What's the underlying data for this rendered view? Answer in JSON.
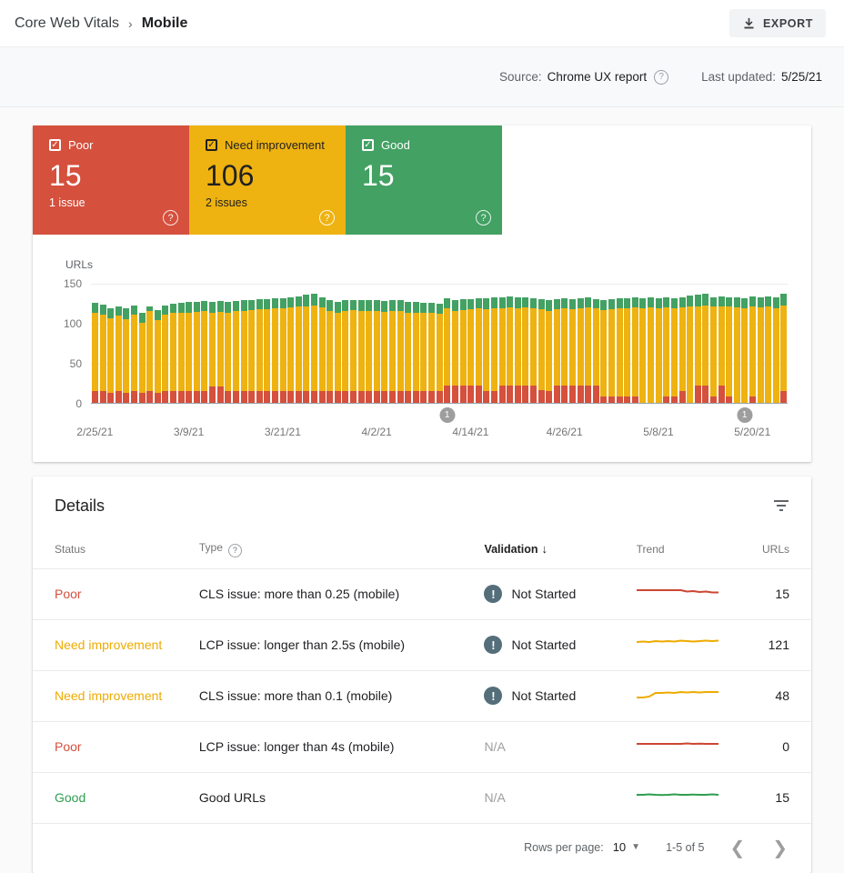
{
  "header": {
    "breadcrumb_root": "Core Web Vitals",
    "breadcrumb_sep": "›",
    "breadcrumb_current": "Mobile",
    "export_label": "EXPORT"
  },
  "source_bar": {
    "source_label": "Source:",
    "source_value": "Chrome UX report",
    "help_icon": "?",
    "updated_label": "Last updated:",
    "updated_value": "5/25/21"
  },
  "summary_cards": [
    {
      "label": "Poor",
      "count": "15",
      "sub": "1 issue",
      "bg": "#d5503d",
      "fg": "#ffffff",
      "check": "✓",
      "help": "?"
    },
    {
      "label": "Need improvement",
      "count": "106",
      "sub": "2 issues",
      "bg": "#eeb211",
      "fg": "#212121",
      "check": "✓",
      "help": "?"
    },
    {
      "label": "Good",
      "count": "15",
      "sub": "",
      "bg": "#43a163",
      "fg": "#ffffff",
      "check": "✓",
      "help": "?"
    }
  ],
  "chart_data": {
    "type": "bar",
    "stacked": true,
    "ylabel": "URLs",
    "ylim": [
      0,
      150
    ],
    "yticks": [
      "150",
      "100",
      "50",
      "0"
    ],
    "grid": true,
    "n_bars": 89,
    "x_tick_labels": [
      "2/25/21",
      "3/9/21",
      "3/21/21",
      "4/2/21",
      "4/14/21",
      "4/26/21",
      "5/8/21",
      "5/20/21"
    ],
    "x_tick_indices": [
      0,
      12,
      24,
      36,
      48,
      60,
      72,
      84
    ],
    "markers": [
      {
        "index": 45,
        "label": "1"
      },
      {
        "index": 83,
        "label": "1"
      }
    ],
    "series": [
      {
        "name": "Poor",
        "color": "#d5503d",
        "values": [
          15,
          15,
          13,
          15,
          13,
          15,
          12,
          15,
          13,
          15,
          15,
          15,
          15,
          15,
          15,
          20,
          20,
          15,
          15,
          15,
          15,
          15,
          15,
          15,
          15,
          15,
          15,
          15,
          15,
          15,
          15,
          15,
          15,
          15,
          15,
          15,
          15,
          15,
          15,
          15,
          15,
          15,
          15,
          15,
          15,
          22,
          22,
          22,
          22,
          22,
          15,
          15,
          22,
          22,
          22,
          22,
          22,
          16,
          15,
          22,
          22,
          22,
          22,
          22,
          22,
          8,
          8,
          8,
          8,
          8,
          0,
          0,
          0,
          8,
          8,
          15,
          0,
          22,
          22,
          8,
          22,
          8,
          0,
          0,
          8,
          0,
          0,
          0,
          15
        ]
      },
      {
        "name": "Need improvement",
        "color": "#eeb211",
        "values": [
          97,
          95,
          93,
          94,
          92,
          95,
          88,
          100,
          90,
          95,
          97,
          98,
          98,
          99,
          100,
          93,
          94,
          98,
          100,
          100,
          101,
          102,
          102,
          103,
          103,
          104,
          105,
          106,
          107,
          104,
          100,
          98,
          100,
          101,
          100,
          100,
          100,
          99,
          100,
          100,
          98,
          98,
          97,
          97,
          96,
          96,
          93,
          94,
          95,
          96,
          102,
          103,
          96,
          97,
          96,
          97,
          96,
          101,
          100,
          95,
          96,
          95,
          96,
          97,
          96,
          108,
          109,
          110,
          110,
          111,
          118,
          119,
          118,
          111,
          110,
          104,
          120,
          99,
          100,
          112,
          99,
          112,
          119,
          118,
          112,
          119,
          120,
          118,
          107
        ]
      },
      {
        "name": "Good",
        "color": "#43a163",
        "values": [
          13,
          13,
          12,
          12,
          13,
          12,
          12,
          5,
          13,
          12,
          12,
          12,
          13,
          12,
          12,
          13,
          13,
          13,
          12,
          13,
          13,
          13,
          13,
          13,
          13,
          13,
          13,
          14,
          14,
          13,
          13,
          13,
          13,
          13,
          13,
          13,
          13,
          13,
          13,
          13,
          13,
          13,
          13,
          13,
          13,
          13,
          13,
          13,
          13,
          13,
          14,
          14,
          14,
          14,
          14,
          13,
          13,
          13,
          13,
          13,
          13,
          13,
          13,
          13,
          12,
          12,
          13,
          13,
          13,
          13,
          13,
          13,
          13,
          13,
          13,
          13,
          14,
          14,
          14,
          12,
          12,
          12,
          13,
          13,
          13,
          13,
          13,
          14,
          14
        ]
      }
    ]
  },
  "details": {
    "title": "Details",
    "headers": {
      "status": "Status",
      "type": "Type",
      "type_help": "?",
      "validation": "Validation",
      "sort_arrow": "↓",
      "trend": "Trend",
      "urls": "URLs"
    },
    "rows": [
      {
        "status": "Poor",
        "status_color": "#d5503d",
        "type": "CLS issue: more than 0.25 (mobile)",
        "validation": "Not Started",
        "validation_icon": "!",
        "urls": "15",
        "spark": {
          "color": "#cc4632",
          "values": [
            8,
            8,
            8,
            8,
            8,
            8,
            8,
            8,
            9.5,
            9,
            10,
            9.5,
            10.5,
            10.5
          ]
        }
      },
      {
        "status": "Need improvement",
        "status_color": "#eeab00",
        "type": "LCP issue: longer than 2.5s (mobile)",
        "validation": "Not Started",
        "validation_icon": "!",
        "urls": "121",
        "spark": {
          "color": "#eeab00",
          "values": [
            9,
            8.5,
            9,
            8,
            8.5,
            8,
            8.5,
            7.5,
            8,
            8.5,
            8,
            7.5,
            8,
            7.5
          ]
        }
      },
      {
        "status": "Need improvement",
        "status_color": "#eeab00",
        "type": "CLS issue: more than 0.1 (mobile)",
        "validation": "Not Started",
        "validation_icon": "!",
        "urls": "48",
        "spark": {
          "color": "#eeab00",
          "values": [
            14,
            14,
            13,
            9,
            9,
            8.5,
            9,
            8,
            8.5,
            8,
            8.5,
            8,
            8,
            8
          ]
        }
      },
      {
        "status": "Poor",
        "status_color": "#d5503d",
        "type": "LCP issue: longer than 4s (mobile)",
        "validation": "N/A",
        "validation_icon": "",
        "urls": "0",
        "spark": {
          "color": "#cc4632",
          "values": [
            9,
            9,
            9,
            9,
            9,
            9,
            9,
            9,
            8.5,
            9,
            8.8,
            9,
            9,
            9
          ]
        }
      },
      {
        "status": "Good",
        "status_color": "#2f9e4f",
        "type": "Good URLs",
        "validation": "N/A",
        "validation_icon": "",
        "urls": "15",
        "spark": {
          "color": "#2f9e4f",
          "values": [
            9,
            9,
            8.5,
            9,
            9.3,
            9,
            8.5,
            9,
            9,
            8.7,
            9,
            9,
            8.5,
            9
          ]
        }
      }
    ],
    "pagination": {
      "rows_per_page_label": "Rows per page:",
      "rows_per_page_value": "10",
      "range_label": "1-5 of 5",
      "prev": "❮",
      "next": "❯"
    }
  }
}
